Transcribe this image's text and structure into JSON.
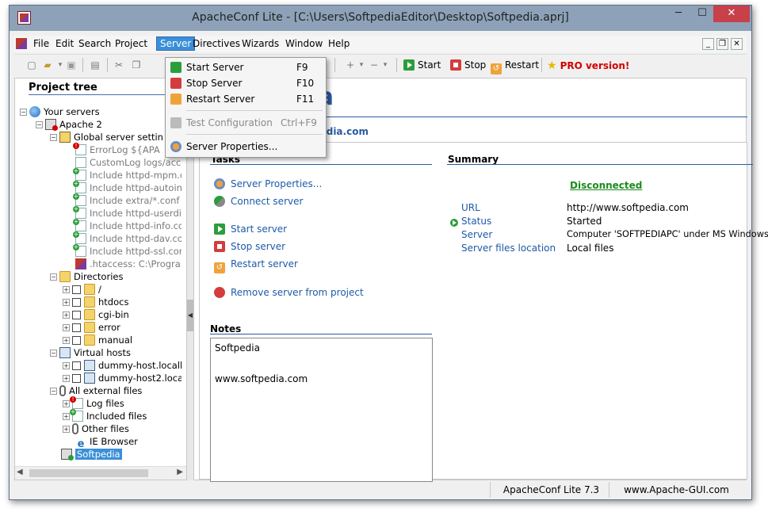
{
  "window": {
    "title": "ApacheConf Lite - [C:\\Users\\SoftpediaEditor\\Desktop\\Softpedia.aprj]",
    "min": "─",
    "max": "☐",
    "close": "✕"
  },
  "menu": {
    "items": [
      "File",
      "Edit",
      "Search",
      "Project",
      "Server",
      "Directives",
      "Wizards",
      "Window",
      "Help"
    ],
    "active": "Server",
    "mdi_min": "_",
    "mdi_restore": "❐",
    "mdi_close": "✕"
  },
  "toolbar": {
    "start": "Start",
    "stop": "Stop",
    "restart": "Restart",
    "pro": "PRO version!",
    "star": "★"
  },
  "server_menu": [
    {
      "label": "Start Server",
      "shortcut": "F9",
      "icon": "green"
    },
    {
      "label": "Stop Server",
      "shortcut": "F10",
      "icon": "red"
    },
    {
      "label": "Restart Server",
      "shortcut": "F11",
      "icon": "orange"
    },
    {
      "label": "Test Configuration",
      "shortcut": "Ctrl+F9",
      "icon": "gray",
      "disabled": true
    },
    {
      "label": "Server Properties...",
      "shortcut": "",
      "icon": "gear"
    }
  ],
  "project_tree": {
    "title": "Project tree",
    "nodes": {
      "your_servers": "Your servers",
      "apache2": "Apache 2",
      "global": "Global server settin",
      "errorlog": "ErrorLog ${APA",
      "customlog": "CustomLog logs/acces",
      "inc_mpm": "Include httpd-mpm.con",
      "inc_autoindex": "Include httpd-autoinde",
      "inc_extra": "Include extra/*.conf",
      "inc_userdir": "Include httpd-userdir.",
      "inc_info": "Include httpd-info.con",
      "inc_dav": "Include httpd-dav.conf",
      "inc_ssl": "Include httpd-ssl.conf",
      "htaccess": ".htaccess: C:\\Program",
      "directories": "Directories",
      "dir_root": "/",
      "dir_htdocs": "htdocs",
      "dir_cgibin": "cgi-bin",
      "dir_error": "error",
      "dir_manual": "manual",
      "virtual_hosts": "Virtual hosts",
      "vh1": "dummy-host.localh",
      "vh2": "dummy-host2.local",
      "external": "All external files",
      "log_files": "Log files",
      "included_files": "Included files",
      "other_files": "Other files",
      "ie_browser": "IE Browser",
      "softpedia": "Softpedia"
    }
  },
  "main": {
    "title": "dia",
    "subtitle": "pedia.com",
    "tasks_header": "Tasks",
    "tasks": [
      "Server Properties...",
      "Connect server",
      "Start server",
      "Stop server",
      "Restart server",
      "Remove server from project"
    ],
    "summary_header": "Summary",
    "connection_status": "Disconnected",
    "summary": [
      {
        "label": "URL",
        "value": "http://www.softpedia.com"
      },
      {
        "label": "Status",
        "value": "Started"
      },
      {
        "label": "Server",
        "value": "Computer 'SOFTPEDIAPC' under MS Windows OS"
      },
      {
        "label": "Server files location",
        "value": "Local files"
      }
    ],
    "notes_header": "Notes",
    "notes": [
      "Softpedia",
      "",
      "www.softpedia.com"
    ]
  },
  "statusbar": {
    "app": "ApacheConf Lite 7.3",
    "site": "www.Apache-GUI.com"
  }
}
